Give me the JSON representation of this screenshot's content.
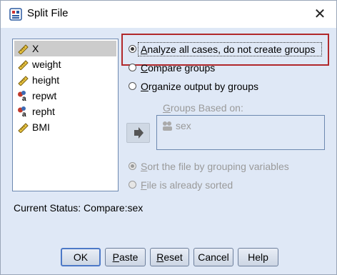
{
  "window": {
    "title": "Split File",
    "icons": {
      "app": "split-file-icon",
      "close": "close-icon"
    }
  },
  "variables": [
    {
      "label": "X",
      "type": "scale",
      "selected": true
    },
    {
      "label": "weight",
      "type": "scale",
      "selected": false
    },
    {
      "label": "height",
      "type": "scale",
      "selected": false
    },
    {
      "label": "repwt",
      "type": "nominal",
      "selected": false
    },
    {
      "label": "repht",
      "type": "nominal",
      "selected": false
    },
    {
      "label": "BMI",
      "type": "scale",
      "selected": false
    }
  ],
  "options": {
    "analyze_all": {
      "mnemonic": "A",
      "rest": "nalyze all cases, do not create groups",
      "checked": true
    },
    "compare": {
      "mnemonic": "C",
      "rest": "ompare groups",
      "checked": false
    },
    "organize": {
      "mnemonic": "O",
      "rest": "rganize output by groups",
      "checked": false
    }
  },
  "groups_based_on": {
    "label_pre": "",
    "mnemonic": "G",
    "label_rest": "roups Based on:",
    "items": [
      "sex"
    ]
  },
  "sort": {
    "sort_by": {
      "mnemonic": "S",
      "rest": "ort the file by grouping variables",
      "checked": true
    },
    "already_sorted": {
      "mnemonic": "F",
      "rest": "ile is already sorted",
      "checked": false
    }
  },
  "status": "Current Status: Compare:sex",
  "buttons": {
    "ok": "OK",
    "paste": {
      "mnemonic": "P",
      "rest": "aste"
    },
    "reset": {
      "mnemonic": "R",
      "rest": "eset"
    },
    "cancel": "Cancel",
    "help": "Help"
  },
  "colors": {
    "highlight_border": "#b1282b",
    "background": "#dfe8f6"
  }
}
